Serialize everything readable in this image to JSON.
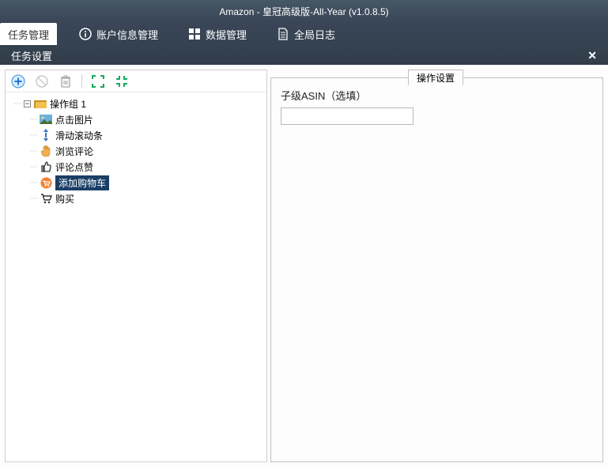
{
  "title": "Amazon - 皇冠高级版-All-Year (v1.0.8.5)",
  "menu": {
    "task_manage": "任务管理",
    "account_manage": "账户信息管理",
    "data_manage": "数据管理",
    "global_log": "全局日志"
  },
  "subbar": {
    "label": "任务设置",
    "close": "✕"
  },
  "toolbar": {
    "add": "＋",
    "disable": "⊘",
    "delete": "🗑",
    "expand": "⛶",
    "collapse": "⤢"
  },
  "tree": {
    "root": "操作组 1",
    "items": [
      {
        "label": "点击图片",
        "selected": false
      },
      {
        "label": "滑动滚动条",
        "selected": false
      },
      {
        "label": "浏览评论",
        "selected": false
      },
      {
        "label": "评论点赞",
        "selected": false
      },
      {
        "label": "添加购物车",
        "selected": true
      },
      {
        "label": "购买",
        "selected": false
      }
    ]
  },
  "right": {
    "tab": "操作设置",
    "field_label": "子级ASIN（选填）",
    "field_value": ""
  }
}
